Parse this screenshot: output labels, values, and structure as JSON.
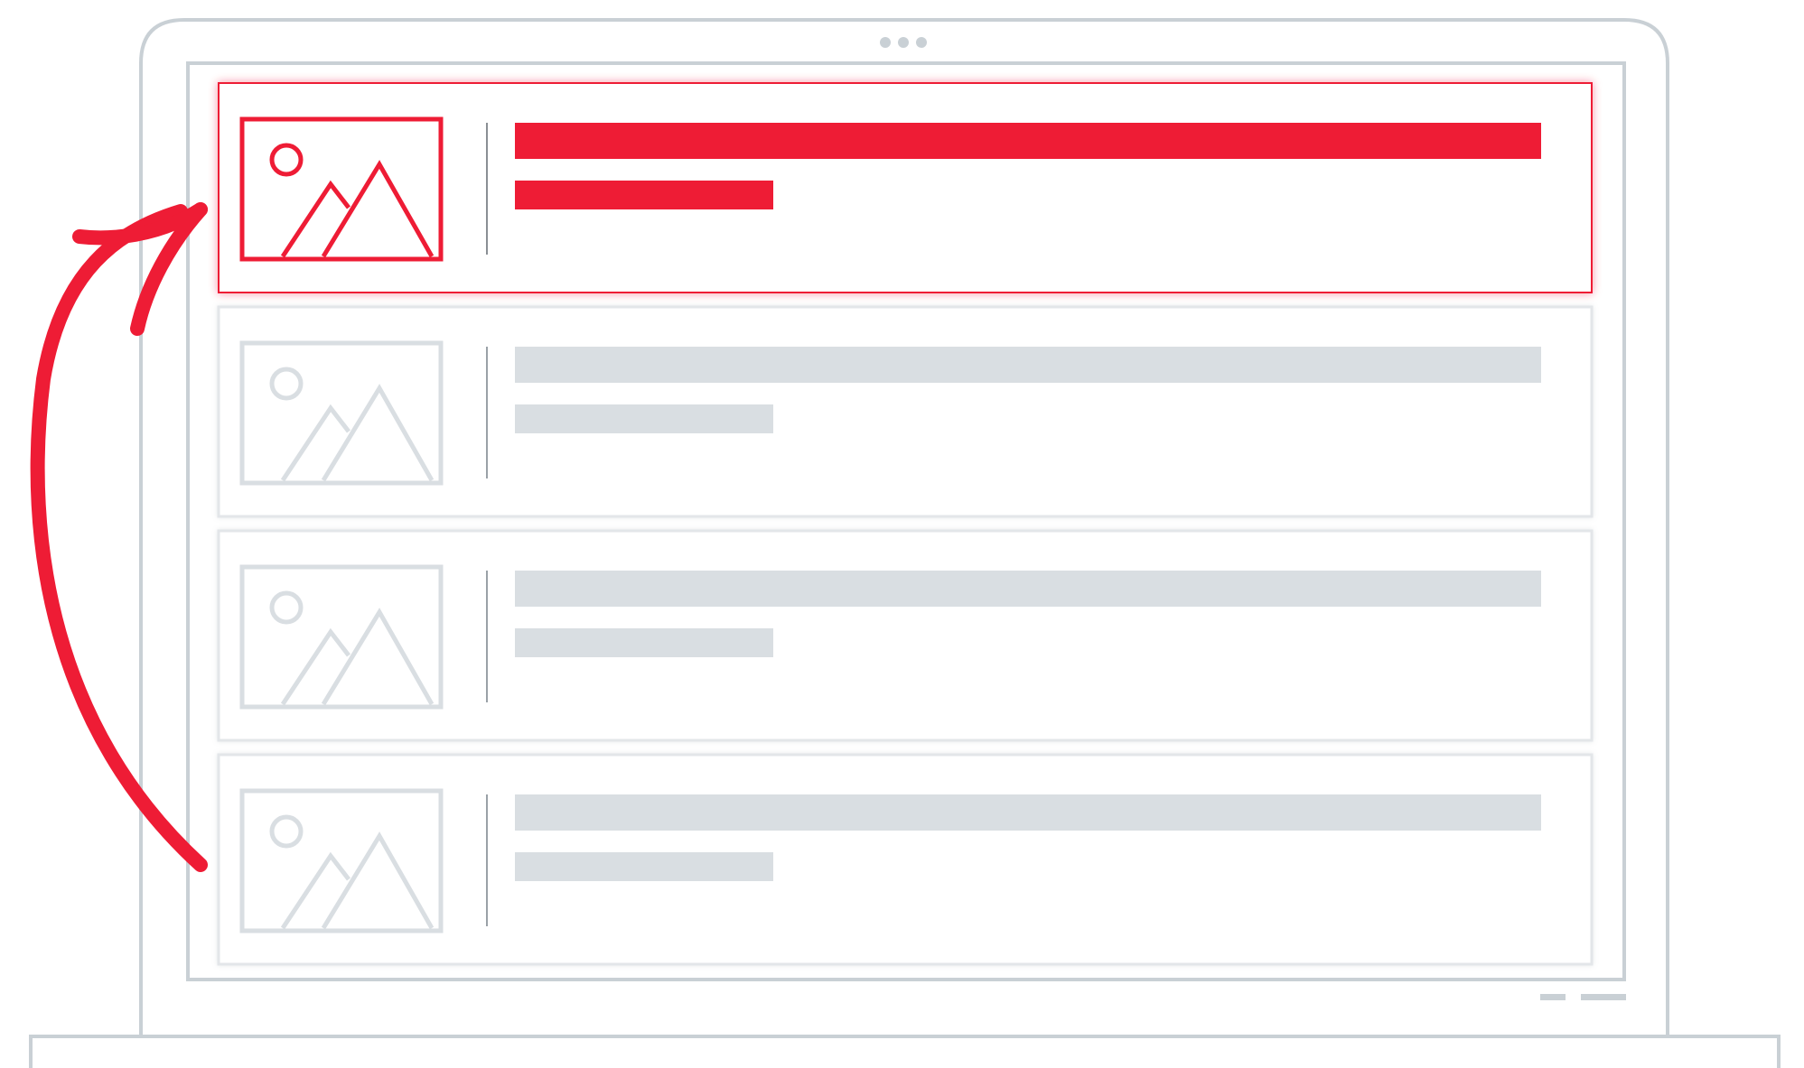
{
  "illustration": {
    "device": "laptop",
    "camera_dots": 3,
    "footer_marks": 2,
    "list": {
      "row_count": 4,
      "highlighted_row_index": 0,
      "row_icon": "image-placeholder-icon",
      "row_content": "text-line-placeholders"
    },
    "arrow": {
      "icon": "curved-arrow-up-icon",
      "from_row_index": 3,
      "to_row_index": 0
    }
  },
  "colors": {
    "accent": "#ee1c35",
    "frame": "#c9d0d5",
    "placeholder": "#d9dee2",
    "card_border": "#e3e6e9",
    "background": "#ffffff"
  }
}
